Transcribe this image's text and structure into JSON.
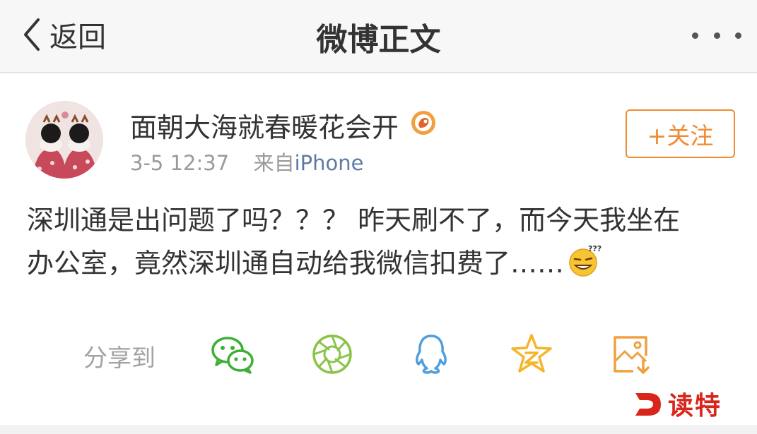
{
  "nav": {
    "back_label": "返回",
    "title": "微博正文",
    "back_icon": "chevron-left-icon",
    "more_icon": "more-dots-icon"
  },
  "post": {
    "author": "面朝大海就春暖花会开",
    "badge_icon": "verified-badge-icon",
    "time": "3-5 12:37",
    "source_prefix": "来自",
    "source": "iPhone",
    "follow_label": "+关注",
    "text_lines": [
      "深圳通是出问题了吗？？？ 昨天刷不了，而今天我坐在",
      "办公室，竟然深圳通自动给我微信扣费了……"
    ],
    "emoji_icon": "confused-emoji-icon"
  },
  "share": {
    "label": "分享到",
    "targets": [
      {
        "name": "wechat",
        "icon": "wechat-icon"
      },
      {
        "name": "moments",
        "icon": "moments-icon"
      },
      {
        "name": "qq",
        "icon": "qq-icon"
      },
      {
        "name": "qzone",
        "icon": "qzone-icon"
      },
      {
        "name": "save-image",
        "icon": "save-image-icon"
      }
    ]
  },
  "watermark": {
    "text": "读特",
    "logo_letter": "D"
  },
  "colors": {
    "accent": "#f08b32",
    "source_link": "#5d7aa6",
    "meta_text": "#9a9a9a",
    "wechat_green": "#3cb034",
    "moments_green": "#8bc34a",
    "qq_blue": "#4f9fe0",
    "qzone_yellow": "#f5b52b",
    "save_orange": "#f0a040",
    "watermark_red": "#d9261c"
  }
}
